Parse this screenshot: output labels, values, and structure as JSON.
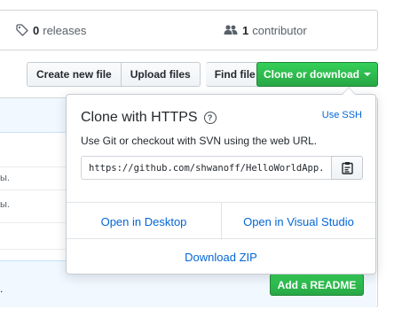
{
  "stats": {
    "releases_count": "0",
    "releases_label": "releases",
    "contributors_count": "1",
    "contributors_label": "contributor"
  },
  "toolbar": {
    "create_new_file": "Create new file",
    "upload_files": "Upload files",
    "find_file": "Find file",
    "clone_or_download": "Clone or download"
  },
  "file_list": {
    "row_texts": [
      "ы.",
      "ы."
    ],
    "readme_bar_text": ".",
    "add_readme": "Add a README"
  },
  "clone_popup": {
    "title": "Clone with HTTPS",
    "help_icon": "?",
    "use_ssh": "Use SSH",
    "description": "Use Git or checkout with SVN using the web URL.",
    "url": "https://github.com/shwanoff/HelloWorldApp.git",
    "open_in_desktop": "Open in Desktop",
    "open_in_visual_studio": "Open in Visual Studio",
    "download_zip": "Download ZIP"
  },
  "colors": {
    "accent_green": "#28a745",
    "link_blue": "#0366d6"
  },
  "icons": [
    "tag-icon",
    "people-icon",
    "question-icon",
    "clipboard-icon",
    "caret-down-icon"
  ]
}
